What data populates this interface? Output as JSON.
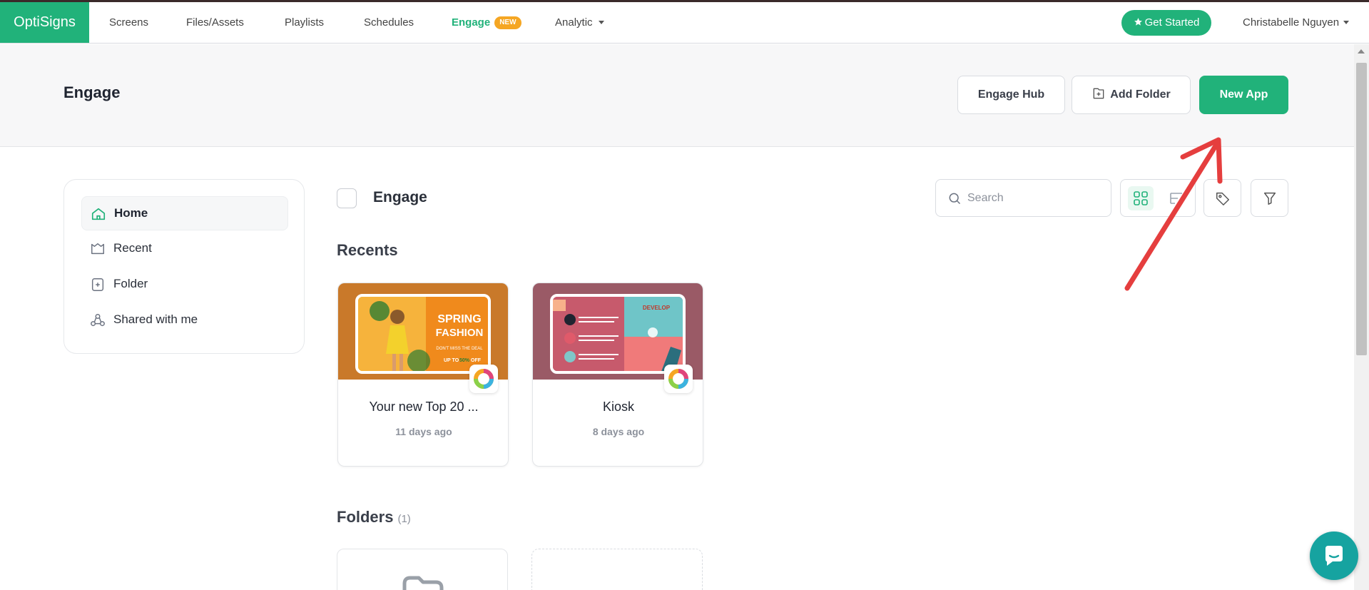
{
  "brand": "OptiSigns",
  "nav": {
    "screens": "Screens",
    "files": "Files/Assets",
    "playlists": "Playlists",
    "schedules": "Schedules",
    "engage": "Engage",
    "engage_badge": "NEW",
    "analytic": "Analytic",
    "get_started": "Get Started",
    "user": "Christabelle Nguyen"
  },
  "header": {
    "title": "Engage",
    "engage_hub": "Engage Hub",
    "add_folder": "Add Folder",
    "new_app": "New App"
  },
  "sidebar": {
    "items": [
      {
        "label": "Home",
        "icon": "home-icon",
        "active": true
      },
      {
        "label": "Recent",
        "icon": "recent-icon"
      },
      {
        "label": "Folder",
        "icon": "folder-add-icon"
      },
      {
        "label": "Shared with me",
        "icon": "shared-icon"
      }
    ]
  },
  "main": {
    "title": "Engage",
    "search_placeholder": "Search",
    "recents_label": "Recents",
    "recents": [
      {
        "title": "Your new Top 20 ...",
        "time": "11 days ago"
      },
      {
        "title": "Kiosk",
        "time": "8 days ago"
      }
    ],
    "folders_label": "Folders",
    "folders_count": "(1)"
  },
  "thumb_text": {
    "spring": "SPRING",
    "fashion": "FASHION",
    "deal": "DON'T MISS THE DEAL",
    "upto": "UP TO",
    "pct": "50%",
    "off": "OFF",
    "develop": "DEVELOP"
  },
  "colors": {
    "accent": "#21b27a",
    "arrow": "#e53e3e",
    "chat": "#16a3a0"
  }
}
